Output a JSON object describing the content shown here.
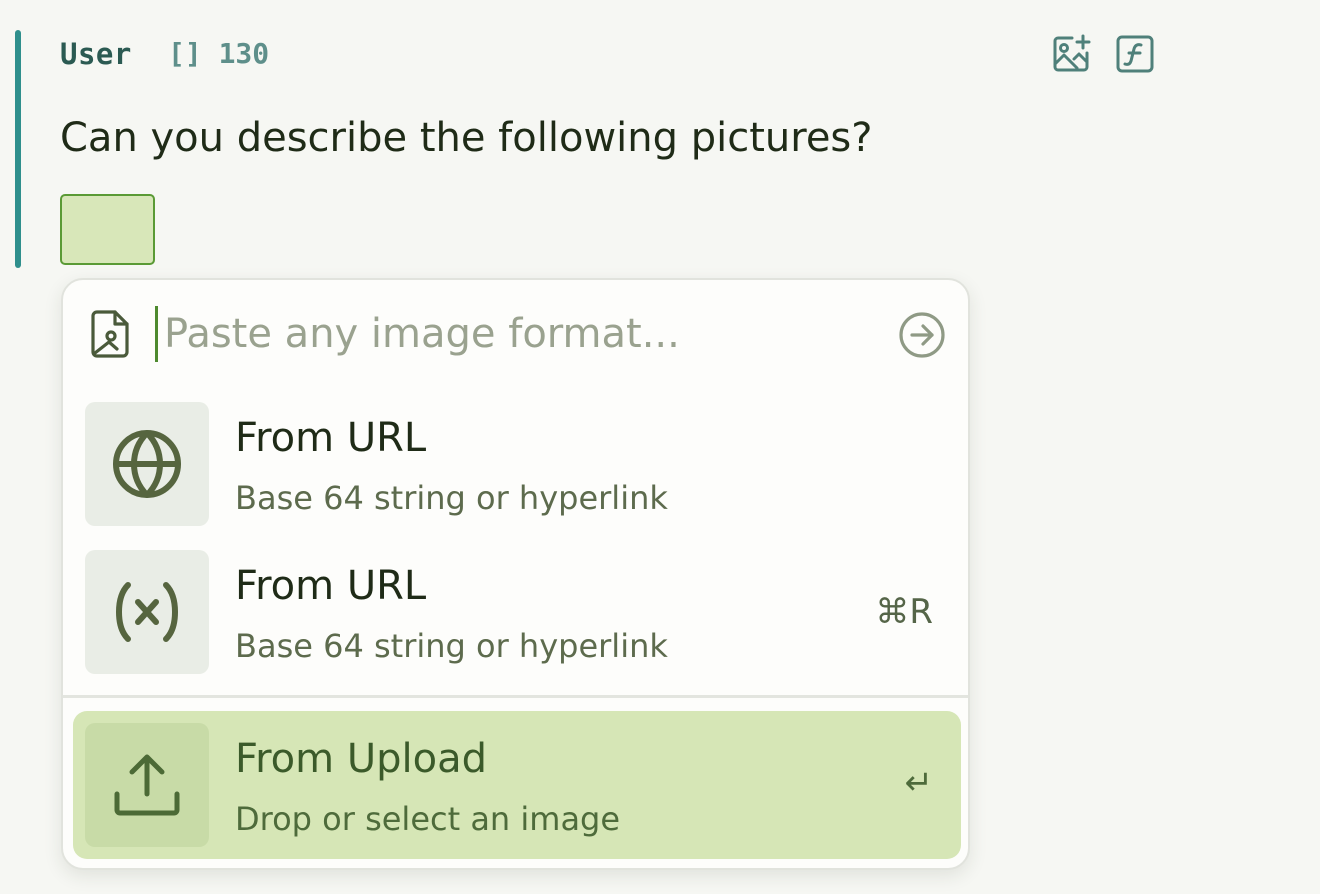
{
  "message": {
    "role": "User",
    "meta": "[] 130",
    "text": "Can you describe the following pictures?",
    "attachment": {
      "icon": "image-thumbnail",
      "fill_color": "#d8e7b9",
      "border_color": "#5a9a35"
    }
  },
  "toolbar": {
    "add_image_icon": "image-plus-icon",
    "function_icon": "function-icon"
  },
  "image_picker": {
    "search": {
      "placeholder": "Paste any image format...",
      "value": "",
      "icon": "file-image-icon",
      "submit_icon": "arrow-right-circle-icon"
    },
    "items": [
      {
        "icon": "globe-icon",
        "title": "From URL",
        "subtitle": "Base 64 string or hyperlink",
        "shortcut": ""
      },
      {
        "icon": "variable-icon",
        "title": "From URL",
        "subtitle": "Base 64 string or hyperlink",
        "shortcut": "⌘R"
      },
      {
        "icon": "upload-icon",
        "title": "From Upload",
        "subtitle": "Drop or select an image",
        "shortcut": "↵",
        "selected": true
      }
    ]
  },
  "colors": {
    "accent_bar": "#2f8f8c",
    "role_text": "#2b5a52",
    "selected_item_bg": "#d6e6b6",
    "icon_stroke": "#5a6b44"
  }
}
